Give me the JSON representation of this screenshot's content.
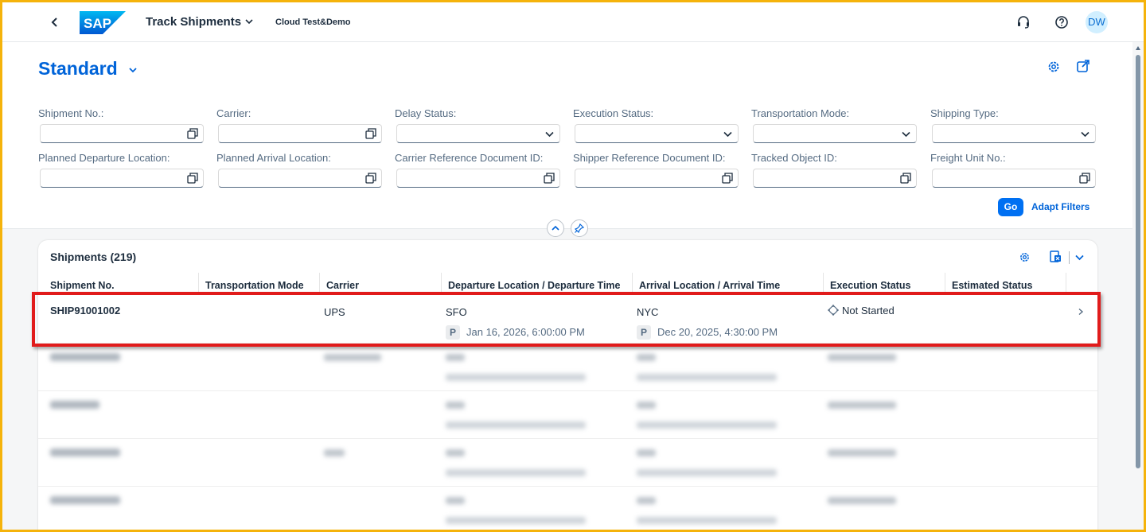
{
  "shell": {
    "app_title": "Track Shipments",
    "system": "Cloud Test&Demo",
    "logo_text": "SAP",
    "avatar": "DW"
  },
  "header": {
    "variant": "Standard",
    "filters": [
      {
        "label": "Shipment No.:",
        "kind": "valuehelp",
        "value": ""
      },
      {
        "label": "Carrier:",
        "kind": "valuehelp",
        "value": ""
      },
      {
        "label": "Delay Status:",
        "kind": "select",
        "value": ""
      },
      {
        "label": "Execution Status:",
        "kind": "select",
        "value": ""
      },
      {
        "label": "Transportation Mode:",
        "kind": "select",
        "value": ""
      },
      {
        "label": "Shipping Type:",
        "kind": "select",
        "value": ""
      },
      {
        "label": "Planned Departure Location:",
        "kind": "valuehelp",
        "value": ""
      },
      {
        "label": "Planned Arrival Location:",
        "kind": "valuehelp",
        "value": ""
      },
      {
        "label": "Carrier Reference Document ID:",
        "kind": "valuehelp",
        "value": ""
      },
      {
        "label": "Shipper Reference Document ID:",
        "kind": "valuehelp",
        "value": ""
      },
      {
        "label": "Tracked Object ID:",
        "kind": "valuehelp",
        "value": ""
      },
      {
        "label": "Freight Unit No.:",
        "kind": "valuehelp",
        "value": ""
      }
    ],
    "go_label": "Go",
    "adapt_label": "Adapt Filters"
  },
  "table": {
    "title": "Shipments (219)",
    "columns": [
      "Shipment No.",
      "Transportation Mode",
      "Carrier",
      "Departure Location / Departure Time",
      "Arrival Location / Arrival Time",
      "Execution Status",
      "Estimated Status"
    ],
    "rows": [
      {
        "shipment_no": "SHIP91001002",
        "mode": "",
        "carrier": "UPS",
        "dep_loc": "SFO",
        "dep_tag": "P",
        "dep_time": "Jan 16, 2026, 6:00:00 PM",
        "arr_loc": "NYC",
        "arr_tag": "P",
        "arr_time": "Dec 20, 2025, 4:30:00 PM",
        "exec_status": "Not Started",
        "est_status": ""
      }
    ]
  },
  "colors": {
    "accent": "#0064d9",
    "button": "#0070f2",
    "highlight": "#e11b1b",
    "frame": "#f5b30b"
  }
}
